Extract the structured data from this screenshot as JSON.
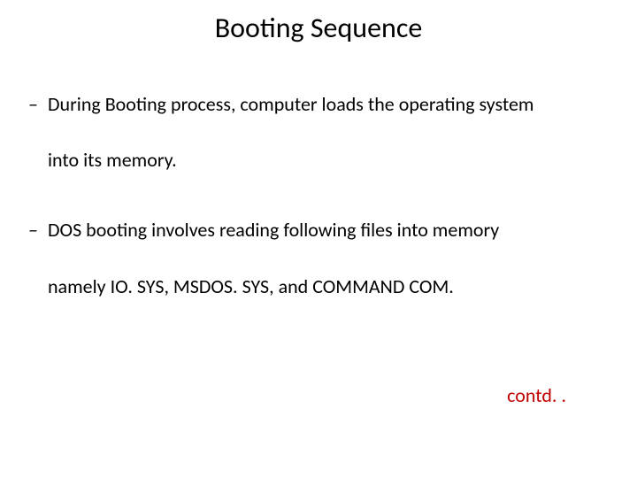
{
  "title": "Booting Sequence",
  "bullets": [
    {
      "dash": "–",
      "line1": "During Booting process, computer loads the operating system",
      "line2": "into its memory."
    },
    {
      "dash": "–",
      "line1": " DOS booting involves reading following files into memory",
      "line2": "namely IO. SYS, MSDOS. SYS, and COMMAND COM."
    }
  ],
  "contd": "contd. ."
}
